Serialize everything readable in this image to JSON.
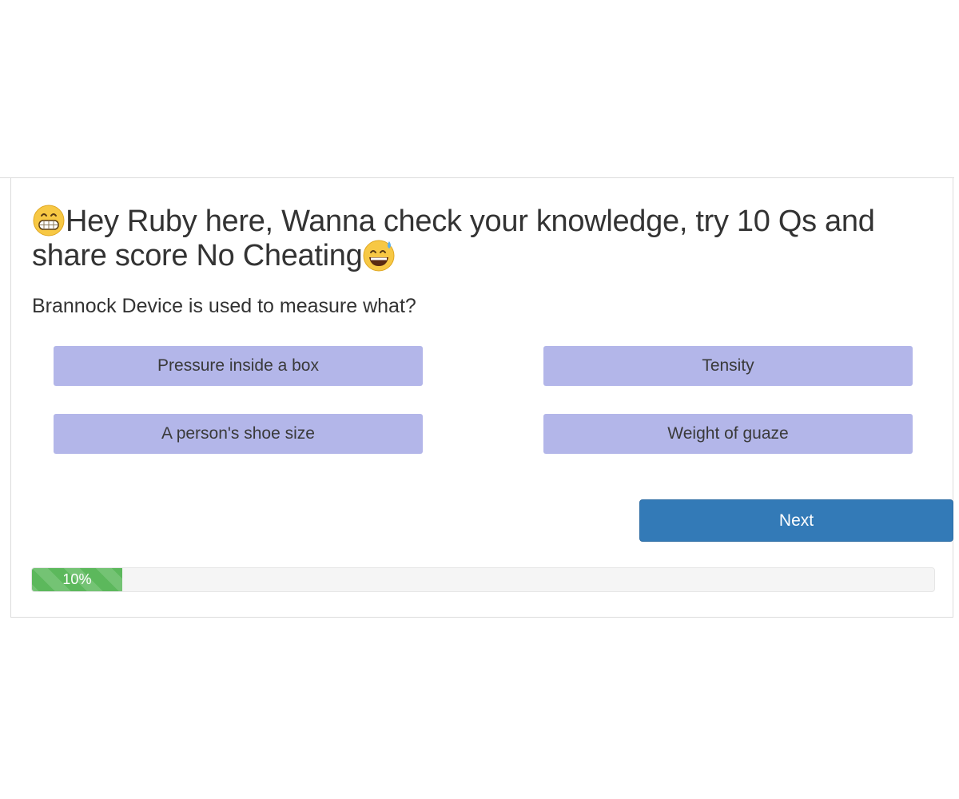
{
  "quiz": {
    "title_text": "Hey Ruby here, Wanna check your knowledge, try 10 Qs and share score No Cheating",
    "title_leading_icon": "grinning-face-emoji-icon",
    "title_trailing_icon": "grinning-sweat-emoji-icon",
    "question": "Brannock Device is used to measure what?",
    "options": [
      {
        "label": "Pressure inside a box"
      },
      {
        "label": "Tensity"
      },
      {
        "label": "A person's shoe size"
      },
      {
        "label": "Weight of guaze"
      }
    ],
    "next_label": "Next",
    "progress": {
      "value_percent": 10,
      "label": "10%"
    }
  },
  "colors": {
    "option_bg": "#b3b6e9",
    "next_bg": "#337ab7",
    "progress_fill": "#5cb85c",
    "progress_track": "#f5f5f5",
    "text": "#333333"
  }
}
